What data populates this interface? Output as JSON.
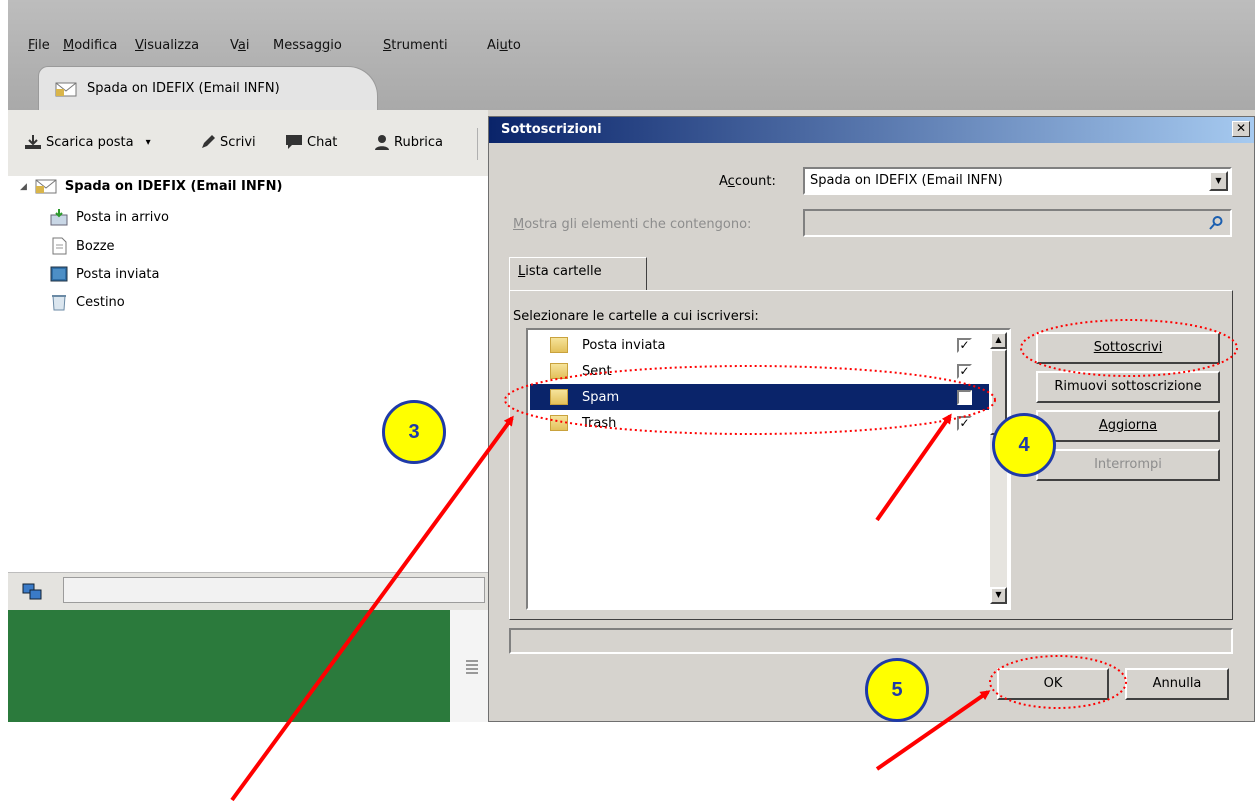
{
  "menubar": {
    "items": [
      {
        "pre": "",
        "u": "F",
        "post": "ile"
      },
      {
        "pre": "",
        "u": "M",
        "post": "odifica"
      },
      {
        "pre": "",
        "u": "V",
        "post": "isualizza"
      },
      {
        "pre": "V",
        "u": "a",
        "post": "i"
      },
      {
        "pre": "Messag",
        "u": "g",
        "post": "io"
      },
      {
        "pre": "",
        "u": "S",
        "post": "trumenti"
      },
      {
        "pre": "Ai",
        "u": "u",
        "post": "to"
      }
    ]
  },
  "tab": {
    "label": "Spada on IDEFIX (Email INFN)"
  },
  "toolbar": {
    "download_label": "Scarica posta",
    "dropdown_glyph": "▾",
    "write_label": "Scrivi",
    "chat_label": "Chat",
    "addressbook_label": "Rubrica"
  },
  "folders": {
    "account": "Spada on IDEFIX (Email INFN)",
    "items": [
      "Posta in arrivo",
      "Bozze",
      "Posta inviata",
      "Cestino"
    ]
  },
  "dialog": {
    "title": "Sottoscrizioni",
    "close_glyph": "✕",
    "account_label_pre": "A",
    "account_label_u": "c",
    "account_label_post": "count:",
    "account_value": "Spada on IDEFIX (Email INFN)",
    "filter_label_pre": "",
    "filter_label_u": "M",
    "filter_label_post": "ostra gli elementi che contengono:",
    "filter_value": "",
    "tab_label_pre": "",
    "tab_label_u": "L",
    "tab_label_post": "ista cartelle",
    "list_caption": "Selezionare le cartelle a cui iscriversi:",
    "folders": [
      {
        "name": "Posta inviata",
        "checked": true,
        "selected": false
      },
      {
        "name": "Sent",
        "checked": true,
        "selected": false
      },
      {
        "name": "Spam",
        "checked": false,
        "selected": true
      },
      {
        "name": "Trash",
        "checked": true,
        "selected": false
      }
    ],
    "buttons": {
      "subscribe": "Sottoscrivi",
      "unsubscribe": "Rimuovi sottoscrizione",
      "refresh": "Aggiorna",
      "stop": "Interrompi",
      "ok": "OK",
      "cancel": "Annulla"
    }
  },
  "annotations": {
    "badges": [
      "3",
      "4",
      "5"
    ],
    "accent_color": "#ff0000",
    "badge_fill": "#ffff00",
    "badge_stroke": "#1f3aa8"
  }
}
